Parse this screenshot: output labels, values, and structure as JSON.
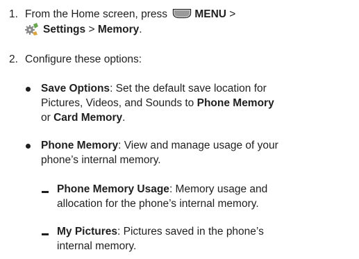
{
  "step1": {
    "number": "1.",
    "prefix": "From the Home screen, press",
    "menu_label": "MENU",
    "sep1": ">",
    "settings_label": "Settings",
    "sep2": ">",
    "memory_label": "Memory",
    "end": ".",
    "icons": {
      "menu_key": "menu-key-icon",
      "settings": "settings-gear-icon"
    }
  },
  "step2": {
    "number": "2.",
    "text": "Configure these options:"
  },
  "bullets": [
    {
      "label": "Save Options",
      "line1": ": Set the default save location for",
      "line2a": "Pictures, Videos, and Sounds to ",
      "line2b": "Phone Memory",
      "line3a": "or ",
      "line3b": "Card Memory",
      "line3c": "."
    },
    {
      "label": "Phone Memory",
      "line1": ": View and manage usage of your",
      "line2": "phone’s internal memory."
    }
  ],
  "subitems": [
    {
      "label": "Phone Memory Usage",
      "line1": ": Memory usage and",
      "line2": "allocation for the phone’s internal memory."
    },
    {
      "label": "My Pictures",
      "line1": ": Pictures saved in the phone’s",
      "line2": "internal memory."
    }
  ],
  "colors": {
    "text": "#1f1f1f",
    "icon_gray": "#9a9a9a",
    "gear_green": "#6aa84f"
  }
}
